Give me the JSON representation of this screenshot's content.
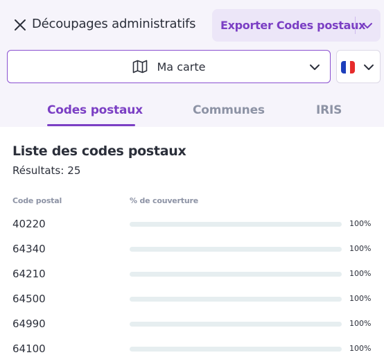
{
  "header": {
    "title": "Découpages administratifs",
    "close_icon": "close-icon",
    "export_label": "Exporter Codes postaux",
    "export_caret_icon": "chevron-down-icon"
  },
  "map_select": {
    "icon": "map-icon",
    "label": "Ma carte",
    "caret_icon": "chevron-down-icon"
  },
  "country_select": {
    "flag": "france-flag",
    "flag_colors": [
      "#1d3fbb",
      "#ffffff",
      "#e62b2b"
    ],
    "caret_icon": "chevron-down-icon"
  },
  "tabs": [
    {
      "label": "Codes postaux",
      "active": true
    },
    {
      "label": "Communes",
      "active": false
    },
    {
      "label": "IRIS",
      "active": false
    }
  ],
  "list": {
    "title": "Liste des codes postaux",
    "results_label": "Résultats:",
    "results_count": "25",
    "columns": {
      "code": "Code postal",
      "coverage": "% de couverture"
    },
    "rows": [
      {
        "code": "40220",
        "coverage": 100,
        "coverage_label": "100%"
      },
      {
        "code": "64340",
        "coverage": 100,
        "coverage_label": "100%"
      },
      {
        "code": "64210",
        "coverage": 100,
        "coverage_label": "100%"
      },
      {
        "code": "64500",
        "coverage": 100,
        "coverage_label": "100%"
      },
      {
        "code": "64990",
        "coverage": 100,
        "coverage_label": "100%"
      },
      {
        "code": "64100",
        "coverage": 100,
        "coverage_label": "100%"
      }
    ]
  },
  "colors": {
    "accent": "#7b3fc4",
    "bar": "#33c4b5",
    "header_bg": "#f6f4fb"
  }
}
